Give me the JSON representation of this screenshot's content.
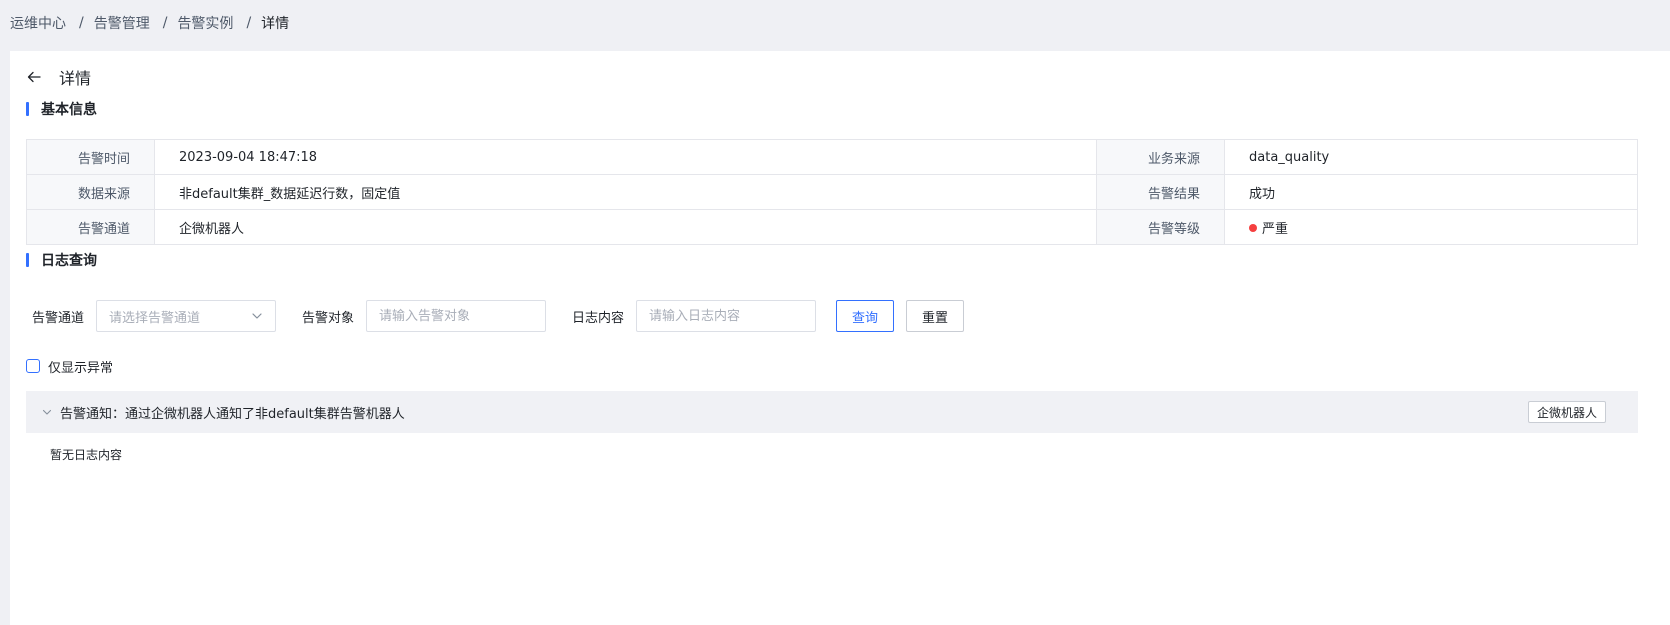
{
  "breadcrumb": {
    "items": [
      "运维中心",
      "告警管理",
      "告警实例"
    ],
    "current": "详情",
    "separator": "/"
  },
  "header": {
    "title": "详情",
    "back_icon": "arrow-left-icon"
  },
  "basic_info": {
    "section_title": "基本信息",
    "rows": [
      {
        "label1": "告警时间",
        "value1": "2023-09-04 18:47:18",
        "label2": "业务来源",
        "value2": "data_quality"
      },
      {
        "label1": "数据来源",
        "value1": "非default集群_数据延迟行数，固定值",
        "label2": "告警结果",
        "value2": "成功"
      },
      {
        "label1": "告警通道",
        "value1": "企微机器人",
        "label2": "告警等级",
        "value2": "严重"
      }
    ],
    "severity_color": "#f53f3f"
  },
  "log_query": {
    "section_title": "日志查询",
    "channel_label": "告警通道",
    "channel_placeholder": "请选择告警通道",
    "target_label": "告警对象",
    "target_placeholder": "请输入告警对象",
    "content_label": "日志内容",
    "content_placeholder": "请输入日志内容",
    "search_label": "查询",
    "reset_label": "重置",
    "only_abnormal_label": "仅显示异常",
    "only_abnormal_checked": false
  },
  "log_panel": {
    "title": "告警通知：通过企微机器人通知了非default集群告警机器人",
    "tag": "企微机器人",
    "empty_text": "暂无日志内容"
  },
  "colors": {
    "accent": "#3370ff",
    "page_bg": "#eff0f4"
  }
}
